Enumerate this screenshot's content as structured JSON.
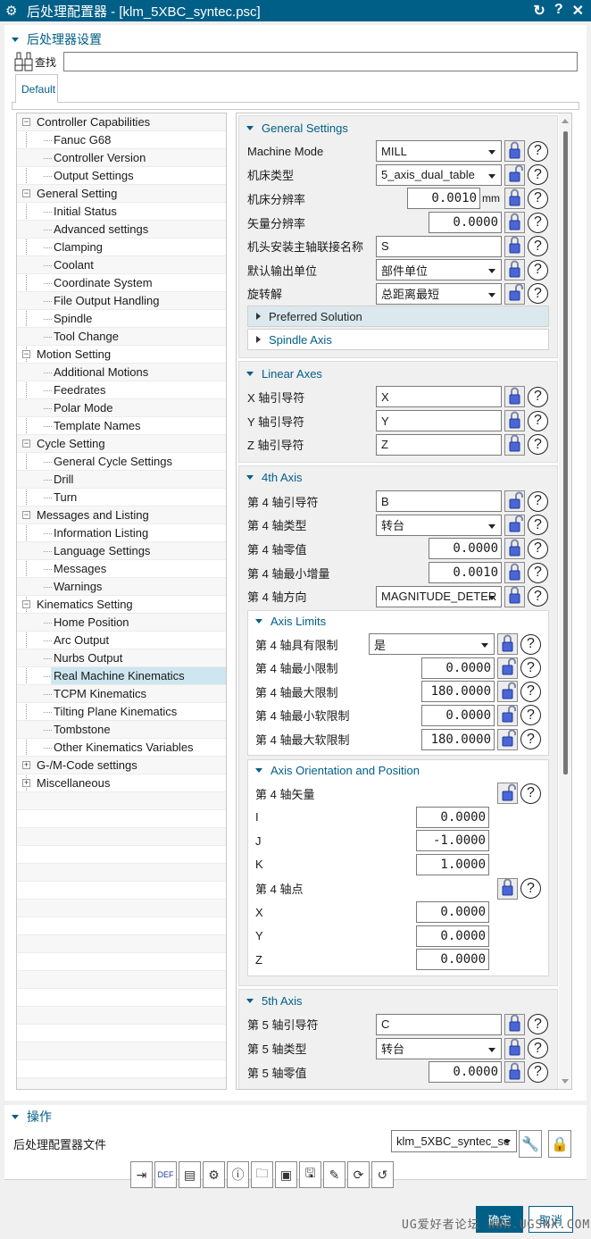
{
  "window": {
    "title": "后处理配置器 - [klm_5XBC_syntec.psc]",
    "icons": [
      "gear-icon",
      "reset-icon",
      "help-icon",
      "close-icon"
    ]
  },
  "settings_group": {
    "title": "后处理器设置",
    "search_label": "查找",
    "search_value": "",
    "tab": "Default"
  },
  "tree": [
    {
      "label": "Controller Capabilities",
      "level": 0,
      "expander": "-"
    },
    {
      "label": "Fanuc G68",
      "level": 1
    },
    {
      "label": "Controller Version",
      "level": 1
    },
    {
      "label": "Output Settings",
      "level": 1
    },
    {
      "label": "General Setting",
      "level": 0,
      "expander": "-"
    },
    {
      "label": "Initial Status",
      "level": 1
    },
    {
      "label": "Advanced settings",
      "level": 1
    },
    {
      "label": "Clamping",
      "level": 1
    },
    {
      "label": "Coolant",
      "level": 1
    },
    {
      "label": "Coordinate System",
      "level": 1
    },
    {
      "label": "File Output Handling",
      "level": 1
    },
    {
      "label": "Spindle",
      "level": 1
    },
    {
      "label": "Tool Change",
      "level": 1
    },
    {
      "label": "Motion Setting",
      "level": 0,
      "expander": "-"
    },
    {
      "label": "Additional Motions",
      "level": 1
    },
    {
      "label": "Feedrates",
      "level": 1
    },
    {
      "label": "Polar Mode",
      "level": 1
    },
    {
      "label": "Template Names",
      "level": 1
    },
    {
      "label": "Cycle Setting",
      "level": 0,
      "expander": "-"
    },
    {
      "label": "General Cycle Settings",
      "level": 1
    },
    {
      "label": "Drill",
      "level": 1
    },
    {
      "label": "Turn",
      "level": 1
    },
    {
      "label": "Messages and Listing",
      "level": 0,
      "expander": "-"
    },
    {
      "label": "Information Listing",
      "level": 1
    },
    {
      "label": "Language Settings",
      "level": 1
    },
    {
      "label": "Messages",
      "level": 1
    },
    {
      "label": "Warnings",
      "level": 1
    },
    {
      "label": "Kinematics Setting",
      "level": 0,
      "expander": "-"
    },
    {
      "label": "Home Position",
      "level": 1
    },
    {
      "label": "Arc Output",
      "level": 1
    },
    {
      "label": "Nurbs Output",
      "level": 1
    },
    {
      "label": "Real Machine Kinematics",
      "level": 1,
      "selected": true
    },
    {
      "label": "TCPM Kinematics",
      "level": 1
    },
    {
      "label": "Tilting Plane Kinematics",
      "level": 1
    },
    {
      "label": "Tombstone",
      "level": 1
    },
    {
      "label": "Other Kinematics Variables",
      "level": 1
    },
    {
      "label": "G-/M-Code settings",
      "level": 0,
      "expander": "+"
    },
    {
      "label": "Miscellaneous",
      "level": 0,
      "expander": "+"
    }
  ],
  "sections": [
    {
      "title": "General Settings",
      "rows": [
        {
          "label": "Machine Mode",
          "type": "select",
          "value": "MILL",
          "lock": "locked"
        },
        {
          "label": "机床类型",
          "type": "select",
          "value": "5_axis_dual_table",
          "lock": "unlocked"
        },
        {
          "label": "机床分辨率",
          "type": "num",
          "value": "0.0010",
          "unit": "mm",
          "lock": "locked"
        },
        {
          "label": "矢量分辨率",
          "type": "num",
          "value": "0.0000",
          "lock": "locked"
        },
        {
          "label": "机头安装主轴联接名称",
          "type": "text",
          "value": "S",
          "lock": "locked"
        },
        {
          "label": "默认输出单位",
          "type": "select",
          "value": "部件单位",
          "lock": "locked"
        },
        {
          "label": "旋转解",
          "type": "select",
          "value": "总距离最短",
          "lock": "unlocked"
        }
      ],
      "collapsed": [
        {
          "title": "Preferred Solution",
          "highlight": true
        },
        {
          "title": "Spindle Axis"
        }
      ]
    },
    {
      "title": "Linear Axes",
      "rows": [
        {
          "label": "X 轴引导符",
          "type": "text",
          "value": "X",
          "lock": "locked"
        },
        {
          "label": "Y 轴引导符",
          "type": "text",
          "value": "Y",
          "lock": "locked"
        },
        {
          "label": "Z 轴引导符",
          "type": "text",
          "value": "Z",
          "lock": "locked"
        }
      ]
    },
    {
      "title": "4th Axis",
      "rows": [
        {
          "label": "第 4 轴引导符",
          "type": "text",
          "value": "B",
          "lock": "unlocked"
        },
        {
          "label": "第 4 轴类型",
          "type": "select",
          "value": "转台",
          "lock": "unlocked"
        },
        {
          "label": "第 4 轴零值",
          "type": "num",
          "value": "0.0000",
          "lock": "locked"
        },
        {
          "label": "第 4 轴最小增量",
          "type": "num",
          "value": "0.0010",
          "lock": "locked"
        },
        {
          "label": "第 4 轴方向",
          "type": "select",
          "value": "MAGNITUDE_DETER",
          "lock": "locked"
        }
      ],
      "subs": [
        {
          "title": "Axis Limits",
          "rows": [
            {
              "label": "第 4 轴具有限制",
              "type": "select",
              "value": "是",
              "lock": "locked"
            },
            {
              "label": "第 4 轴最小限制",
              "type": "num",
              "value": "0.0000",
              "lock": "unlocked"
            },
            {
              "label": "第 4 轴最大限制",
              "type": "num",
              "value": "180.0000",
              "lock": "unlocked"
            },
            {
              "label": "第 4 轴最小软限制",
              "type": "num",
              "value": "0.0000",
              "lock": "unlocked"
            },
            {
              "label": "第 4 轴最大软限制",
              "type": "num",
              "value": "180.0000",
              "lock": "unlocked"
            }
          ]
        },
        {
          "title": "Axis Orientation and Position",
          "rows": [
            {
              "label": "第 4 轴矢量",
              "lock": "unlocked"
            },
            {
              "label": "I",
              "type": "num",
              "value": "0.0000",
              "nolock": true
            },
            {
              "label": "J",
              "type": "num",
              "value": "-1.0000",
              "nolock": true
            },
            {
              "label": "K",
              "type": "num",
              "value": "1.0000",
              "nolock": true
            },
            {
              "label": "第 4 轴点",
              "lock": "locked"
            },
            {
              "label": "X",
              "type": "num",
              "value": "0.0000",
              "nolock": true
            },
            {
              "label": "Y",
              "type": "num",
              "value": "0.0000",
              "nolock": true
            },
            {
              "label": "Z",
              "type": "num",
              "value": "0.0000",
              "nolock": true
            }
          ]
        }
      ]
    },
    {
      "title": "5th Axis",
      "rows": [
        {
          "label": "第 5 轴引导符",
          "type": "text",
          "value": "C",
          "lock": "locked"
        },
        {
          "label": "第 5 轴类型",
          "type": "select",
          "value": "转台",
          "lock": "locked"
        },
        {
          "label": "第 5 轴零值",
          "type": "num",
          "value": "0.0000",
          "lock": "locked"
        }
      ]
    }
  ],
  "operations": {
    "title": "操作",
    "file_label": "后处理配置器文件",
    "file_value": "klm_5XBC_syntec_se",
    "toolbar": [
      "export-icon",
      "definition-file-icon",
      "edit-template-icon",
      "settings-stack-icon",
      "info-icon",
      "open-folder-icon",
      "save-as-template-icon",
      "save-icon",
      "save-edit-icon",
      "refresh-copy-icon",
      "undo-icon"
    ]
  },
  "footer": {
    "ok": "确定",
    "cancel": "取消",
    "watermark": "UG爱好者论坛 WWW.UGSNX.COM"
  },
  "colors": {
    "accent": "#005f87",
    "selected": "#cde6ef",
    "highlight_row": "#dbe9ee"
  }
}
